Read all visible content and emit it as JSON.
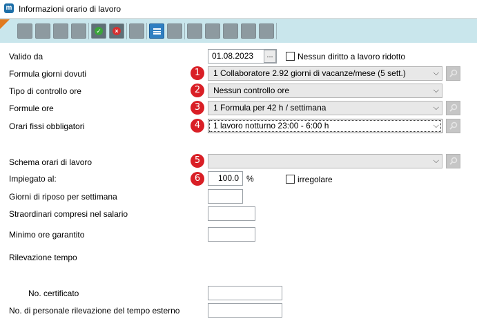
{
  "window": {
    "title": "Informazioni orario di lavoro",
    "app_icon_letter": "m"
  },
  "form": {
    "valido_da": {
      "label": "Valido da",
      "value": "01.08.2023",
      "picker_label": "..."
    },
    "nessun_diritto": {
      "label": "Nessun diritto a lavoro ridotto",
      "checked": false
    },
    "formula_giorni": {
      "label": "Formula giorni dovuti",
      "badge": "1",
      "value": "1 Collaboratore 2.92 giorni di vacanze/mese (5 sett.)"
    },
    "tipo_controllo": {
      "label": "Tipo di controllo ore",
      "badge": "2",
      "value": "Nessun controllo ore"
    },
    "formule_ore": {
      "label": "Formule ore",
      "badge": "3",
      "value": "1 Formula per 42 h / settimana"
    },
    "orari_fissi": {
      "label": "Orari fissi obbligatori",
      "badge": "4",
      "value": "1 lavoro notturno 23:00 - 6:00 h"
    },
    "schema_orari": {
      "label": "Schema orari di lavoro",
      "badge": "5",
      "value": ""
    },
    "impiegato": {
      "label": "Impiegato al:",
      "badge": "6",
      "value": "100.0",
      "unit": "%"
    },
    "irregolare": {
      "label": "irregolare",
      "checked": false
    },
    "giorni_riposo": {
      "label": "Giorni di riposo per settimana",
      "value": ""
    },
    "straordinari": {
      "label": "Straordinari compresi nel salario",
      "value": ""
    },
    "minimo_ore": {
      "label": "Minimo ore garantito",
      "value": ""
    },
    "rilevazione": {
      "label": "Rilevazione tempo"
    },
    "no_certificato": {
      "label": "No. certificato",
      "value": ""
    },
    "no_personale": {
      "label": "No. di personale rilevazione del tempo esterno",
      "value": ""
    }
  },
  "colors": {
    "badge": "#d91f26",
    "toolbar_bg": "#c9e6ec",
    "accent_blue": "#2f7fc1"
  }
}
